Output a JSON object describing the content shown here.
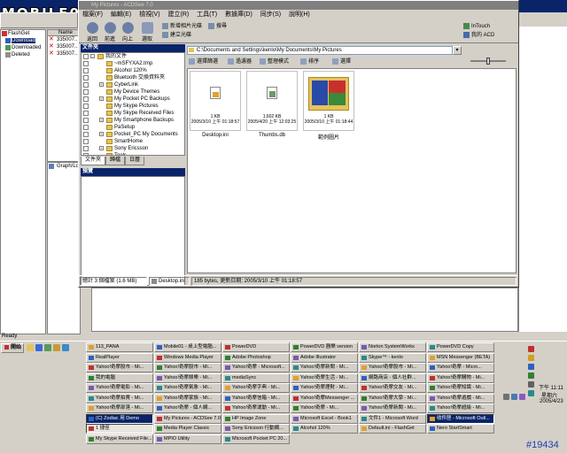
{
  "flashget": {
    "title": "FlashGet",
    "logo": "MOBILE01",
    "tree": [
      "FlashGet",
      "Download",
      "Downloaded",
      "Deleted"
    ],
    "list_header": "Name",
    "list_items": [
      "335007...",
      "335007...",
      "335007..."
    ],
    "graph_item": "Graph/Log",
    "ready": "Ready"
  },
  "acdsee": {
    "title": "My Pictures - ACDSee 7.0",
    "menu": [
      "檔案(F)",
      "編輯(E)",
      "檢視(V)",
      "建立(R)",
      "工具(T)",
      "數據庫(D)",
      "同步(S)",
      "說明(H)"
    ],
    "toolbar": {
      "back": "返回",
      "forward": "前進",
      "up": "向上",
      "select": "選取",
      "new_album": "新增相片光碟",
      "new_folder": "建立光碟",
      "search": "搜尋",
      "intouch": "InTouch",
      "my_acd": "我的 ACD"
    },
    "folders_title": "文件夾",
    "folders": [
      {
        "name": "我的文件",
        "indent": 0,
        "expand": "-"
      },
      {
        "name": "~mSFYXA2.tmp",
        "indent": 1,
        "expand": ""
      },
      {
        "name": "Alcohol 120%",
        "indent": 1,
        "expand": ""
      },
      {
        "name": "Bluetooth 交換資料夾",
        "indent": 1,
        "expand": ""
      },
      {
        "name": "CyberLink",
        "indent": 1,
        "expand": "+"
      },
      {
        "name": "My Device Themes",
        "indent": 1,
        "expand": ""
      },
      {
        "name": "My Pocket PC Backups",
        "indent": 1,
        "expand": "+"
      },
      {
        "name": "My Skype Pictures",
        "indent": 1,
        "expand": ""
      },
      {
        "name": "My Skype Received Files",
        "indent": 1,
        "expand": ""
      },
      {
        "name": "My Smartphone Backups",
        "indent": 1,
        "expand": "+"
      },
      {
        "name": "PaSetup",
        "indent": 1,
        "expand": ""
      },
      {
        "name": "Pocket_PC My Documents",
        "indent": 1,
        "expand": "+"
      },
      {
        "name": "SmartHome",
        "indent": 1,
        "expand": ""
      },
      {
        "name": "Sony Ericsson",
        "indent": 1,
        "expand": "+"
      },
      {
        "name": "Tools",
        "indent": 1,
        "expand": ""
      }
    ],
    "left_tabs": [
      "文件夾",
      "歸檔",
      "日曆"
    ],
    "preview_title": "預覽",
    "address": "C:\\Documents and Settings\\kenlo\\My Documents\\My Pictures",
    "view_toolbar": [
      "選擇篩選",
      "過濾器",
      "整理模式",
      "排序",
      "選擇"
    ],
    "files": [
      {
        "name": "Desktop.ini",
        "size": "1 KB",
        "date": "2005/3/10 上午 01:18:57"
      },
      {
        "name": "Thumbs.db",
        "size": "1,602 KB",
        "date": "2005/4/20 上午 12:03:25"
      },
      {
        "name": "範例圖片",
        "size": "1 KB",
        "date": "2005/3/10 上午 01:18:44"
      }
    ],
    "status": {
      "total": "總計 3 個檔案 (1.6 MB)",
      "selected": "Desktop.ini",
      "info": "185 bytes, 更新日期: 2005/3/10 上午 01:18:57"
    }
  },
  "taskbar": {
    "start": "開始",
    "tasks": [
      [
        "113_PANA",
        "Mobile01 - 桌上型電腦...",
        "PowerDVD",
        "PowerDVD 器樂 version",
        "Norton SystemWorks",
        "PowerDVD Copy"
      ],
      [
        "RealPlayer",
        "Windows Media Player",
        "Adobe Photoshop",
        "Adobe Illustrator",
        "Skype™ - kenlo",
        "MSN Messenger (BETA)"
      ],
      [
        "Yahoo!奇摩股市 - Mi...",
        "Yahoo!奇摩股市 - Mi...",
        "Yahoo!奇摩 - Microsoft...",
        "Yahoo!奇摩新聞 - Mi...",
        "Yahoo!奇摩股市 - Mi...",
        "Yahoo!奇摩 - Micro..."
      ],
      [
        "我的電腦",
        "Yahoo!奇摩娛樂 - Mi...",
        "mediaSync",
        "Yahoo!奇摩生活 - Mi...",
        "網路商店 - 個人社群...",
        "Yahoo!奇摩購物 - Mi..."
      ],
      [
        "Yahoo!奇摩電影 - Mi...",
        "Yahoo!奇摩氣象 - Mi...",
        "Yahoo!奇摩字典 - Mi...",
        "Yahoo!奇摩理財 - Mi...",
        "Yahoo!奇摩交友 - Mi...",
        "Yahoo!奇摩知識 - Mi..."
      ],
      [
        "Yahoo!奇摩拍賣 - Mi...",
        "Yahoo!奇摩家族 - Mi...",
        "Yahoo!奇摩信箱 - Mi...",
        "Yahoo!奇摩Messenger ...",
        "Yahoo!奇摩大學 - Mi...",
        "Yahoo!奇摩遊戲 - Mi..."
      ],
      [
        "Yahoo!奇摩部落 - Mi...",
        "Yahoo!奇摩 - 個人網...",
        "Yahoo!奇摩運動 - Mi...",
        "Yahoo!奇摩 - Mi...",
        "Yahoo!奇摩新聞 - Mi...",
        "Yahoo!奇摩超級 - Mi..."
      ],
      [
        "(C) Zodiac 用 Demo",
        "My Pictures - ACDSee 7.0",
        "HP Image Zone",
        "Microsoft Excel - Book1",
        "文件1 - Microsoft Word",
        "收件匣 - Microsoft Outl..."
      ],
      [
        "1 捷徑",
        "Media Player Classic",
        "Sony Ericsson 行動網...",
        "Alcohol 120%",
        "Default.ini - FlashGet",
        "Nero StartSmart"
      ],
      [
        "My Skype Received File...",
        "MPIO Utility",
        "Microsoft Pocket PC 20...",
        "",
        "",
        ""
      ]
    ],
    "clock": {
      "time": "下午 11:11",
      "day": "星期六",
      "date": "2005/4/23"
    }
  },
  "watermark": "#19434"
}
